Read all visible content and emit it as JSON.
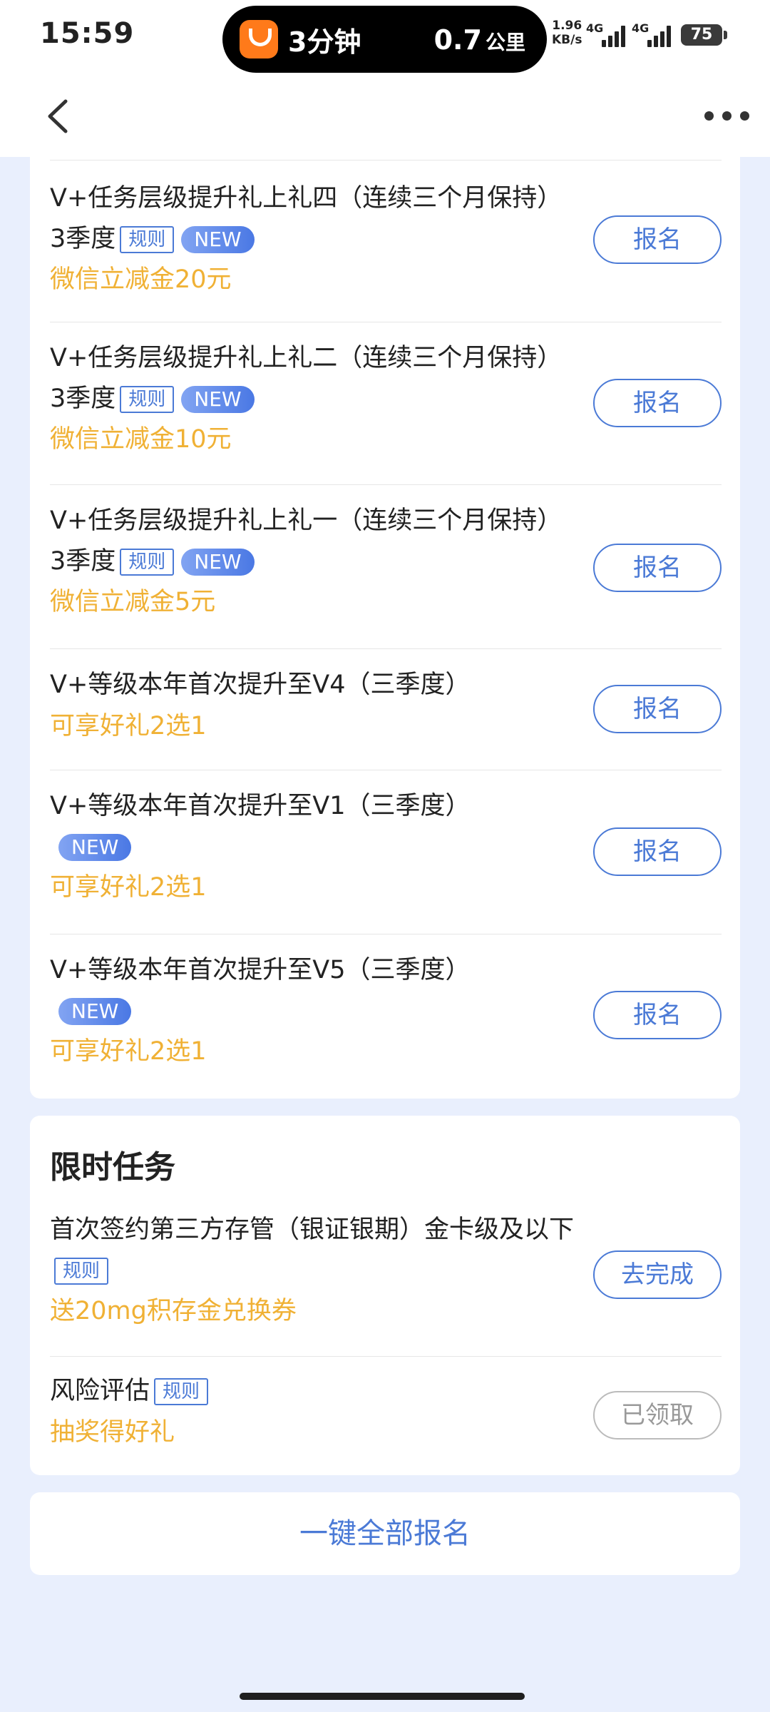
{
  "status_bar": {
    "time": "15:59",
    "island": {
      "eta": "3分钟",
      "distance_value": "0.7",
      "distance_unit": "公里",
      "app_icon": "didi-icon"
    },
    "net_speed_value": "1.96",
    "net_speed_unit": "KB/s",
    "signal_1_label": "4G",
    "signal_2_label": "4G",
    "battery": "75"
  },
  "nav": {
    "back_icon": "chevron-left-icon",
    "more_icon": "more-dots-icon"
  },
  "upgrade_tasks": [
    {
      "title": "V+任务层级提升礼上礼四（连续三个月保持）3季度",
      "rule": "规则",
      "new": "NEW",
      "reward": "微信立减金20元",
      "button": "报名"
    },
    {
      "title": "V+任务层级提升礼上礼二（连续三个月保持）3季度",
      "rule": "规则",
      "new": "NEW",
      "reward": "微信立减金10元",
      "button": "报名"
    },
    {
      "title": "V+任务层级提升礼上礼一（连续三个月保持）3季度",
      "rule": "规则",
      "new": "NEW",
      "reward": "微信立减金5元",
      "button": "报名"
    },
    {
      "title": "V+等级本年首次提升至V4（三季度）",
      "reward": "可享好礼2选1",
      "button": "报名"
    },
    {
      "title": "V+等级本年首次提升至V1（三季度）",
      "new": "NEW",
      "reward": "可享好礼2选1",
      "button": "报名"
    },
    {
      "title": "V+等级本年首次提升至V5（三季度）",
      "new": "NEW",
      "reward": "可享好礼2选1",
      "button": "报名"
    }
  ],
  "limited_section": {
    "title": "限时任务",
    "tasks": [
      {
        "title": "首次签约第三方存管（银证银期）金卡级及以下",
        "rule": "规则",
        "reward": "送20mg积存金兑换券",
        "button": "去完成"
      },
      {
        "title": "风险评估",
        "rule": "规则",
        "reward": "抽奖得好礼",
        "button": "已领取"
      }
    ]
  },
  "sign_all_button": "一键全部报名",
  "colors": {
    "accent": "#4b7ad6",
    "reward": "#f0b135",
    "background": "#e9effd"
  }
}
